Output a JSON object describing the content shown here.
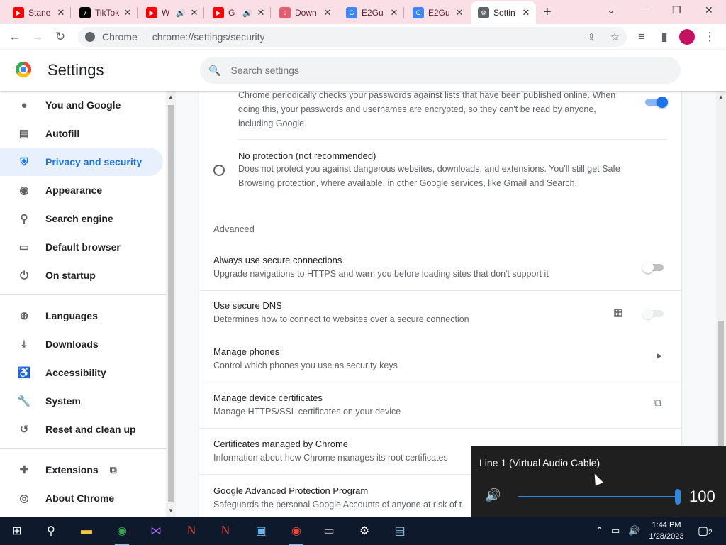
{
  "browser": {
    "tabs": [
      {
        "title": "Stane",
        "favicon": "youtube-icon",
        "fav_color": "#ff0000"
      },
      {
        "title": "TikTok",
        "favicon": "tiktok-icon",
        "fav_color": "#000000"
      },
      {
        "title": "W",
        "favicon": "youtube-icon",
        "fav_color": "#ff0000",
        "audio": true
      },
      {
        "title": "G",
        "favicon": "youtube-icon",
        "fav_color": "#ff0000",
        "audio": true
      },
      {
        "title": "Down",
        "favicon": "download-icon",
        "fav_color": "#e06070"
      },
      {
        "title": "E2Gu",
        "favicon": "google-icon",
        "fav_color": "#4285f4"
      },
      {
        "title": "E2Gu",
        "favicon": "google-icon",
        "fav_color": "#4285f4"
      },
      {
        "title": "Settin",
        "favicon": "gear-icon",
        "fav_color": "#5f6368",
        "active": true
      }
    ],
    "omnibox": {
      "chip": "Chrome",
      "url": "chrome://settings/security"
    }
  },
  "header": {
    "title": "Settings",
    "search_placeholder": "Search settings"
  },
  "sidebar": {
    "items": [
      {
        "label": "You and Google",
        "icon": "person-icon"
      },
      {
        "label": "Autofill",
        "icon": "clipboard-icon"
      },
      {
        "label": "Privacy and security",
        "icon": "shield-icon",
        "active": true
      },
      {
        "label": "Appearance",
        "icon": "palette-icon"
      },
      {
        "label": "Search engine",
        "icon": "search-icon"
      },
      {
        "label": "Default browser",
        "icon": "browser-icon"
      },
      {
        "label": "On startup",
        "icon": "power-icon"
      },
      {
        "label": "Languages",
        "icon": "globe-icon"
      },
      {
        "label": "Downloads",
        "icon": "download-icon"
      },
      {
        "label": "Accessibility",
        "icon": "accessibility-icon"
      },
      {
        "label": "System",
        "icon": "wrench-icon"
      },
      {
        "label": "Reset and clean up",
        "icon": "history-icon"
      },
      {
        "label": "Extensions",
        "icon": "puzzle-icon"
      },
      {
        "label": "About Chrome",
        "icon": "chrome-icon"
      }
    ]
  },
  "main": {
    "password_check_desc": "Chrome periodically checks your passwords against lists that have been published online. When doing this, your passwords and usernames are encrypted, so they can't be read by anyone, including Google.",
    "no_protection": {
      "title": "No protection (not recommended)",
      "desc": "Does not protect you against dangerous websites, downloads, and extensions. You'll still get Safe Browsing protection, where available, in other Google services, like Gmail and Search."
    },
    "advanced_heading": "Advanced",
    "rows": [
      {
        "title": "Always use secure connections",
        "desc": "Upgrade navigations to HTTPS and warn you before loading sites that don't support it"
      },
      {
        "title": "Use secure DNS",
        "desc": "Determines how to connect to websites over a secure connection"
      },
      {
        "title": "Manage phones",
        "desc": "Control which phones you use as security keys"
      },
      {
        "title": "Manage device certificates",
        "desc": "Manage HTTPS/SSL certificates on your device"
      },
      {
        "title": "Certificates managed by Chrome",
        "desc": "Information about how Chrome manages its root certificates"
      },
      {
        "title": "Google Advanced Protection Program",
        "desc": "Safeguards the personal Google Accounts of anyone at risk of t"
      }
    ]
  },
  "volume_flyout": {
    "device": "Line 1 (Virtual Audio Cable)",
    "level": "100"
  },
  "taskbar": {
    "time": "1:44 PM",
    "date": "1/28/2023",
    "notifications": "2"
  }
}
